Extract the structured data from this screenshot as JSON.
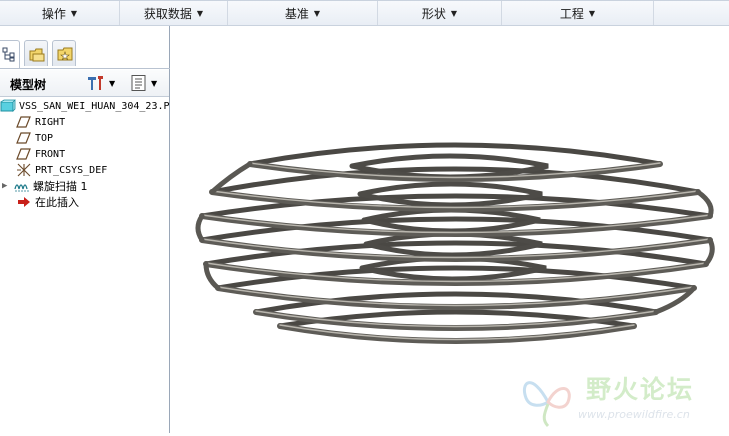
{
  "groups": [
    {
      "label": "操作"
    },
    {
      "label": "获取数据"
    },
    {
      "label": "基准"
    },
    {
      "label": "形状"
    },
    {
      "label": "工程"
    }
  ],
  "model_tree": {
    "title": "模型树",
    "items": [
      {
        "label": "VSS_SAN_WEI_HUAN_304_23.P",
        "icon": "part-icon"
      },
      {
        "label": "RIGHT",
        "icon": "datum-plane-icon"
      },
      {
        "label": "TOP",
        "icon": "datum-plane-icon"
      },
      {
        "label": "FRONT",
        "icon": "datum-plane-icon"
      },
      {
        "label": "PRT_CSYS_DEF",
        "icon": "csys-icon"
      },
      {
        "label": "螺旋扫描 1",
        "icon": "helical-sweep-icon"
      },
      {
        "label": "在此插入",
        "icon": "insert-here-arrow-icon"
      }
    ]
  },
  "watermark": {
    "title": "野火论坛",
    "url": "www.proewildfire.cn"
  },
  "colors": {
    "spring": "#5a5853",
    "spring_highlight": "#b9b6ae",
    "insert_arrow": "#c8201a",
    "part_icon": "#2bb5c8"
  }
}
